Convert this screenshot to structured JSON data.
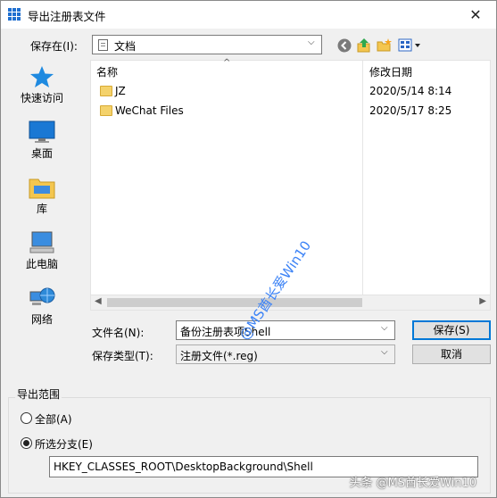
{
  "window": {
    "title": "导出注册表文件"
  },
  "save_in": {
    "label": "保存在(I):",
    "value": "文档"
  },
  "places": [
    {
      "label": "快速访问",
      "icon": "star-icon"
    },
    {
      "label": "桌面",
      "icon": "desktop-icon"
    },
    {
      "label": "库",
      "icon": "library-icon"
    },
    {
      "label": "此电脑",
      "icon": "computer-icon"
    },
    {
      "label": "网络",
      "icon": "network-icon"
    }
  ],
  "file_list": {
    "columns": [
      "名称",
      "修改日期"
    ],
    "rows": [
      {
        "name": "JZ",
        "modified": "2020/5/14 8:14"
      },
      {
        "name": "WeChat Files",
        "modified": "2020/5/17 8:25"
      }
    ]
  },
  "filename": {
    "label": "文件名(N):",
    "value": "备份注册表项Shell"
  },
  "filetype": {
    "label": "保存类型(T):",
    "value": "注册文件(*.reg)"
  },
  "buttons": {
    "save": "保存(S)",
    "cancel": "取消"
  },
  "export_range": {
    "title": "导出范围",
    "all_label": "全部(A)",
    "selected_label": "所选分支(E)",
    "selected": "selected_branch",
    "branch_path": "HKEY_CLASSES_ROOT\\DesktopBackground\\Shell"
  },
  "watermark": {
    "diagonal": "@MS酋长爱Win10",
    "corner": "头条 @MS酋长爱Win10"
  }
}
